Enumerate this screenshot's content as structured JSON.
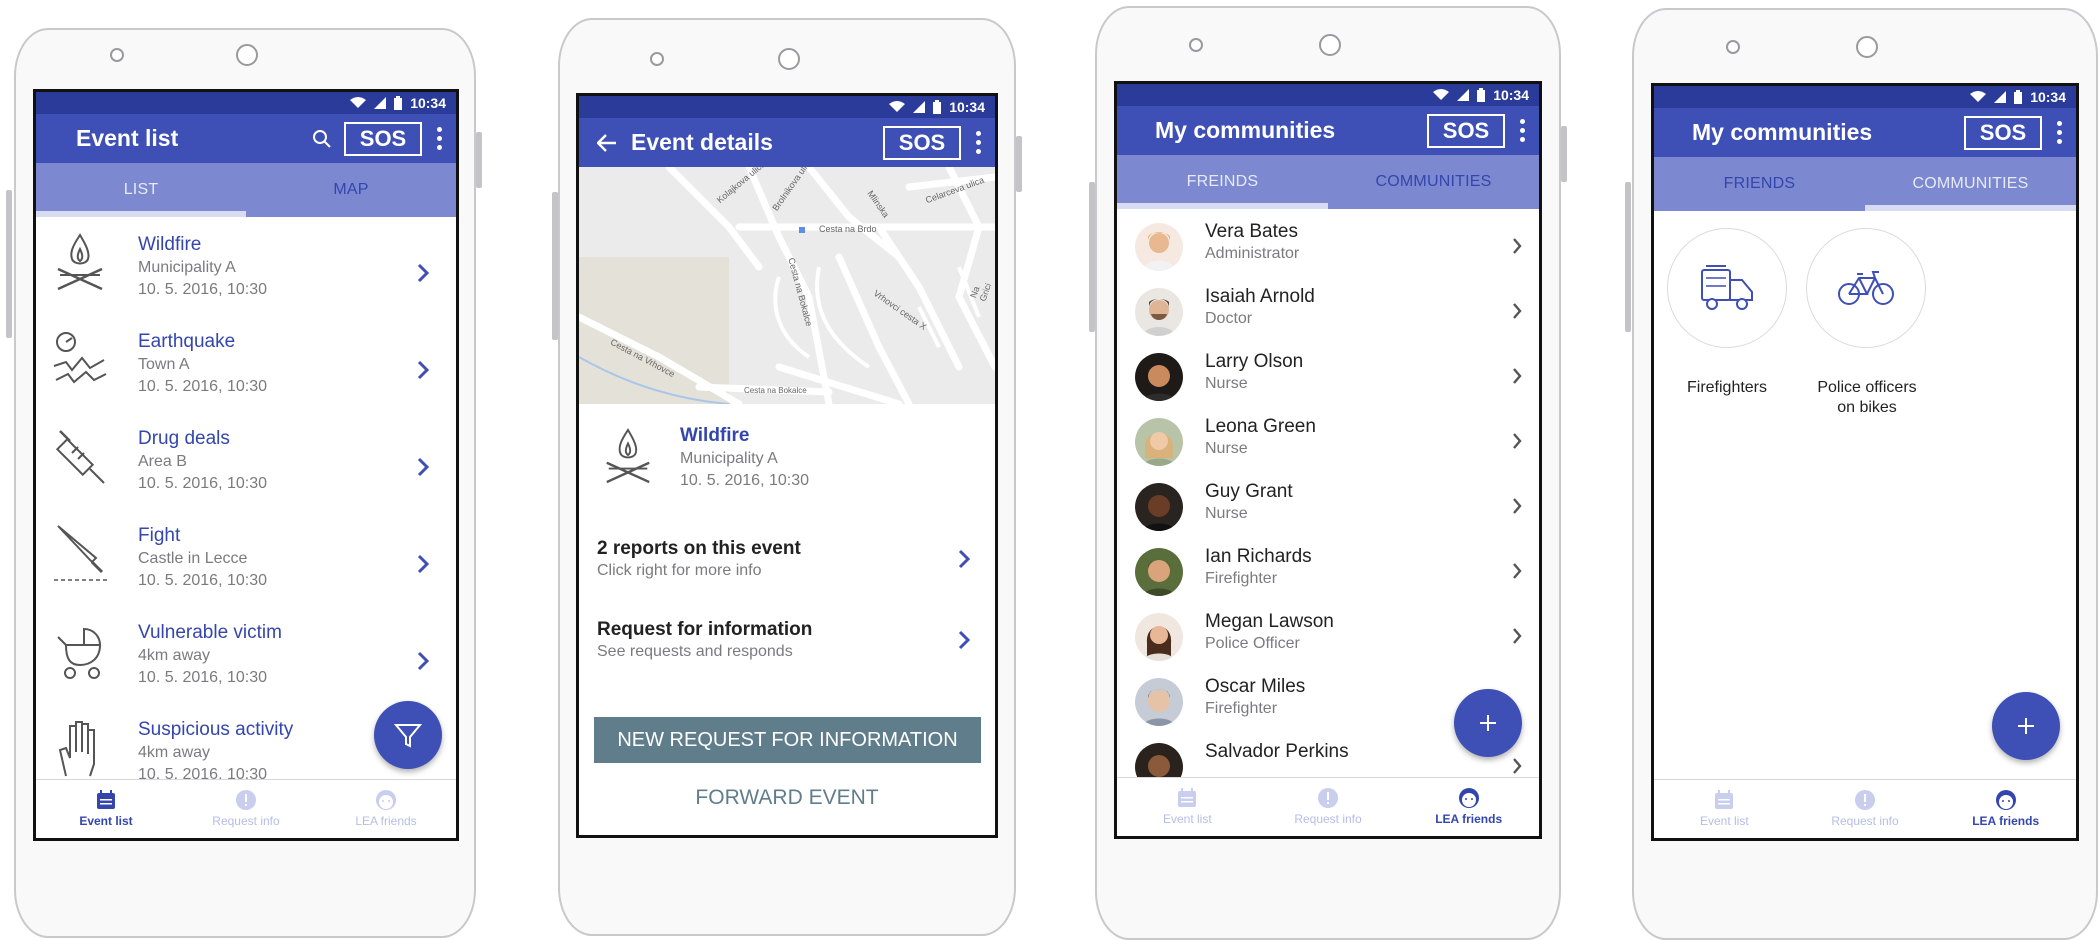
{
  "status_bar": {
    "time": "10:34"
  },
  "screen1": {
    "title": "Event list",
    "sos_label": "SOS",
    "tabs": [
      {
        "label": "LIST"
      },
      {
        "label": "MAP"
      }
    ],
    "events": [
      {
        "title": "Wildfire",
        "location": "Municipality A",
        "date": "10. 5. 2016, 10:30",
        "icon": "campfire-icon"
      },
      {
        "title": "Earthquake",
        "location": "Town A",
        "date": "10. 5. 2016, 10:30",
        "icon": "earthquake-icon"
      },
      {
        "title": "Drug deals",
        "location": "Area B",
        "date": "10. 5. 2016, 10:30",
        "icon": "syringe-icon"
      },
      {
        "title": "Fight",
        "location": "Castle in Lecce",
        "date": "10. 5. 2016, 10:30",
        "icon": "knife-icon"
      },
      {
        "title": "Vulnerable victim",
        "location": "4km away",
        "date": "10. 5. 2016, 10:30",
        "icon": "stroller-icon"
      },
      {
        "title": "Suspicious activity",
        "location": "4km away",
        "date": "10. 5. 2016, 10:30",
        "icon": "hand-icon"
      }
    ]
  },
  "screen2": {
    "title": "Event details",
    "sos_label": "SOS",
    "map_streets": [
      "Kolajkova ulica",
      "Brolnikova ulica",
      "Mlinska",
      "Celarceva ulica",
      "Cesta na Brdo",
      "Cesta na Bokalce",
      "Vrhovci cesta X",
      "Cesta na Vrhovce",
      "Na Grici"
    ],
    "event": {
      "title": "Wildfire",
      "location": "Municipality A",
      "date": "10. 5. 2016, 10:30"
    },
    "rows": [
      {
        "title": "2 reports on this event",
        "subtitle": "Click right for more info"
      },
      {
        "title": "Request for information",
        "subtitle": "See requests and responds"
      }
    ],
    "primary_button": "NEW REQUEST FOR INFORMATION",
    "secondary_button": "FORWARD EVENT"
  },
  "screen3": {
    "title": "My communities",
    "sos_label": "SOS",
    "tabs": [
      {
        "label": "FREINDS"
      },
      {
        "label": "COMMUNITIES"
      }
    ],
    "friends": [
      {
        "name": "Vera Bates",
        "role": "Administrator"
      },
      {
        "name": "Isaiah Arnold",
        "role": "Doctor"
      },
      {
        "name": "Larry Olson",
        "role": "Nurse"
      },
      {
        "name": "Leona Green",
        "role": "Nurse"
      },
      {
        "name": "Guy Grant",
        "role": "Nurse"
      },
      {
        "name": "Ian Richards",
        "role": "Firefighter"
      },
      {
        "name": "Megan Lawson",
        "role": "Police Officer"
      },
      {
        "name": "Oscar Miles",
        "role": "Firefighter"
      },
      {
        "name": "Salvador Perkins",
        "role": ""
      }
    ]
  },
  "screen4": {
    "title": "My communities",
    "sos_label": "SOS",
    "tabs": [
      {
        "label": "FRIENDS"
      },
      {
        "label": "COMMUNITIES"
      }
    ],
    "communities": [
      {
        "label": "Firefighters",
        "icon": "fire-truck-icon"
      },
      {
        "label_line1": "Police officers",
        "label_line2": "on bikes",
        "icon": "bicycle-icon"
      }
    ]
  },
  "bottom_nav": [
    {
      "label": "Event list",
      "icon": "calendar-icon"
    },
    {
      "label": "Request info",
      "icon": "exclamation-icon"
    },
    {
      "label": "LEA friends",
      "icon": "face-icon"
    }
  ],
  "colors": {
    "primary": "#3e4fb5",
    "primary_dark": "#2b3b99",
    "tab_bar": "#7c88cf",
    "link_blue": "#3446ad",
    "button_slate": "#607d8b"
  }
}
